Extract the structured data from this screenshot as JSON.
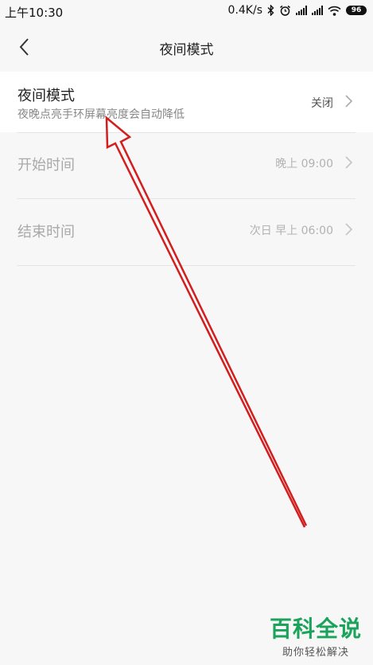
{
  "status_bar": {
    "time": "上午10:30",
    "network_speed": "0.4K/s",
    "battery_level": "96"
  },
  "header": {
    "title": "夜间模式"
  },
  "settings": {
    "night_mode": {
      "title": "夜间模式",
      "subtitle": "夜晚点亮手环屏幕亮度会自动降低",
      "value": "关闭"
    },
    "start_time": {
      "title": "开始时间",
      "value": "晚上 09:00"
    },
    "end_time": {
      "title": "结束时间",
      "value": "次日 早上 06:00"
    }
  },
  "watermark": {
    "main": "百科全说",
    "sub": "助你轻松解决"
  },
  "colors": {
    "background": "#f7f7f7",
    "annotation_arrow": "#d21e1e",
    "watermark_green": "#1aa35a"
  }
}
